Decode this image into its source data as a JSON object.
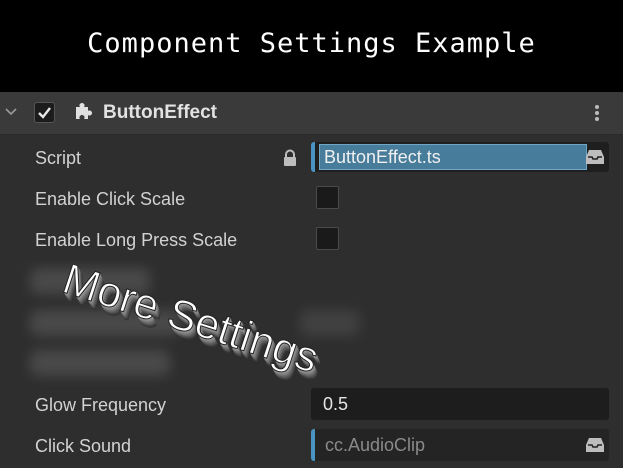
{
  "banner": {
    "title": "Component Settings Example"
  },
  "component": {
    "name": "ButtonEffect",
    "enabled": true,
    "icons": {
      "collapse": "chevron-down-icon",
      "component": "puzzle-icon",
      "menu": "kebab-menu-icon"
    }
  },
  "properties": {
    "script": {
      "label": "Script",
      "value": "ButtonEffect.ts",
      "locked": true
    },
    "enable_click_scale": {
      "label": "Enable Click Scale",
      "checked": false
    },
    "enable_long_press_scale": {
      "label": "Enable Long Press Scale",
      "checked": false
    },
    "glow_frequency": {
      "label": "Glow Frequency",
      "value": "0.5"
    },
    "click_sound": {
      "label": "Click Sound",
      "value": "cc.AudioClip"
    }
  },
  "overlay": {
    "text": "More Settings"
  },
  "colors": {
    "accent": "#4a94c4",
    "panel_bg": "#2e2e2e",
    "header_bg": "#3a3a3a",
    "script_highlight": "#477d9b"
  }
}
